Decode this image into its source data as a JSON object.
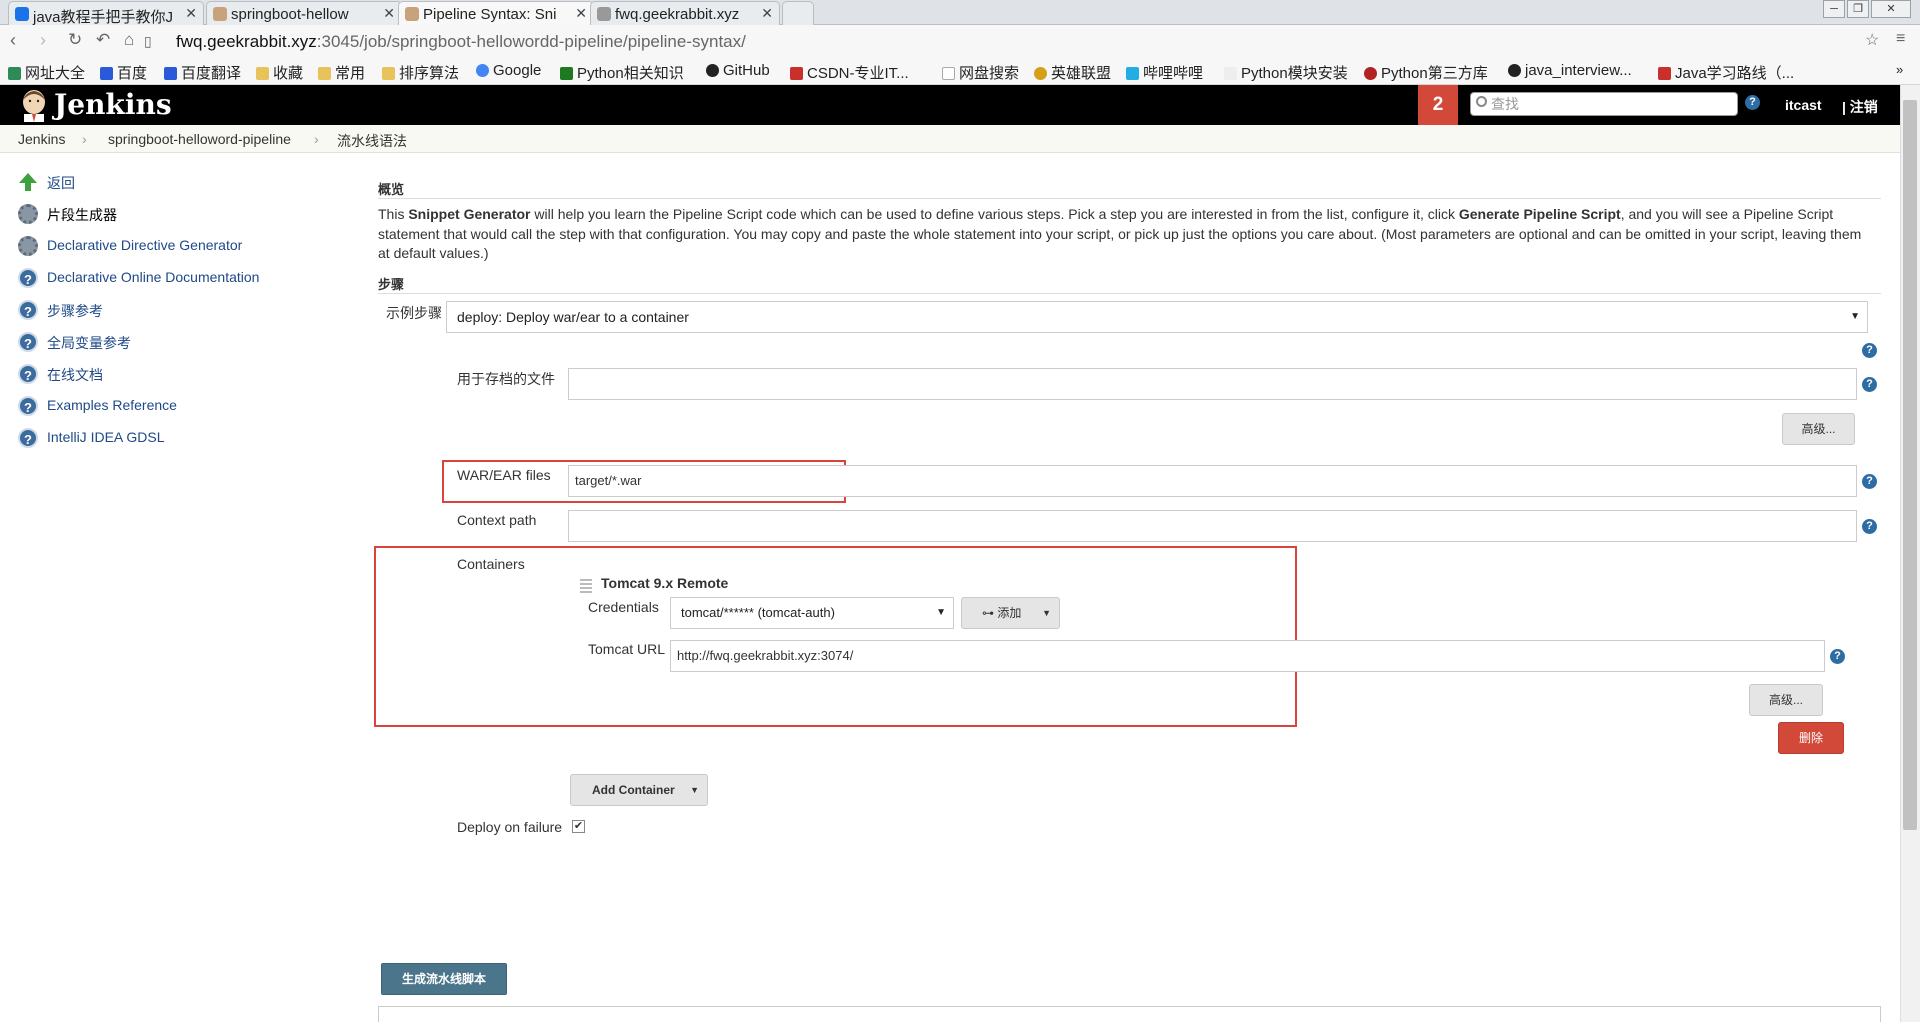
{
  "browser": {
    "tabs": [
      {
        "title": "java教程手把手教你J",
        "icon_color": "#1a73e8"
      },
      {
        "title": "springboot-hellow",
        "icon_color": "#8a6d3b"
      },
      {
        "title": "Pipeline Syntax: Sni",
        "icon_color": "#8a6d3b"
      },
      {
        "title": "fwq.geekrabbit.xyz",
        "icon_color": "#777777"
      }
    ],
    "url_host": "fwq.geekrabbit.xyz",
    "url_rest": ":3045/job/springboot-hellowordd-pipeline/pipeline-syntax/",
    "bookmarks": [
      {
        "label": "网址大全",
        "color": "#2e8b57"
      },
      {
        "label": "百度",
        "color": "#2a5ad8"
      },
      {
        "label": "百度翻译",
        "color": "#2a5ad8"
      },
      {
        "label": "收藏",
        "color": "#e8c25a"
      },
      {
        "label": "常用",
        "color": "#e8c25a"
      },
      {
        "label": "排序算法",
        "color": "#e8c25a"
      },
      {
        "label": "Google",
        "color": "#4285f4"
      },
      {
        "label": "Python相关知识",
        "color": "#1f7a1f"
      },
      {
        "label": "GitHub",
        "color": "#222222"
      },
      {
        "label": "CSDN-专业IT...",
        "color": "#c9302c"
      },
      {
        "label": "网盘搜索",
        "color": "#aaaaaa"
      },
      {
        "label": "英雄联盟",
        "color": "#d4a017"
      },
      {
        "label": "哔哩哔哩",
        "color": "#23ade5"
      },
      {
        "label": "Python模块安装",
        "color": "#dddddd"
      },
      {
        "label": "Python第三方库",
        "color": "#b22222"
      },
      {
        "label": "java_interview...",
        "color": "#222222"
      },
      {
        "label": "Java学习路线（...",
        "color": "#c9302c"
      }
    ]
  },
  "header": {
    "logo": "Jenkins",
    "notification_count": "2",
    "search_placeholder": "查找",
    "user": "itcast",
    "logout": "| 注销"
  },
  "breadcrumb": [
    "Jenkins",
    "springboot-helloword-pipeline",
    "流水线语法"
  ],
  "sidebar": [
    {
      "label": "返回",
      "icon": "up-arrow-icon"
    },
    {
      "label": "片段生成器",
      "icon": "gear-icon"
    },
    {
      "label": "Declarative Directive Generator",
      "icon": "gear-icon"
    },
    {
      "label": "Declarative Online Documentation",
      "icon": "help-icon"
    },
    {
      "label": "步骤参考",
      "icon": "help-icon"
    },
    {
      "label": "全局变量参考",
      "icon": "help-icon"
    },
    {
      "label": "在线文档",
      "icon": "help-icon"
    },
    {
      "label": "Examples Reference",
      "icon": "help-icon"
    },
    {
      "label": "IntelliJ IDEA GDSL",
      "icon": "help-icon"
    }
  ],
  "main": {
    "overview_title": "概览",
    "desc_1": "This ",
    "desc_bold1": "Snippet Generator",
    "desc_2": " will help you learn the Pipeline Script code which can be used to define various steps. Pick a step you are interested in from the list, configure it, click ",
    "desc_bold2": "Generate Pipeline Script",
    "desc_3": ", and you will see a Pipeline Script statement that would call the step with that configuration. You may copy and paste the whole statement into your script, or pick up just the options you care about. (Most parameters are optional and can be omitted in your script, leaving them at default values.)",
    "steps_title": "步骤",
    "sample_step_label": "示例步骤",
    "sample_step_value": "deploy: Deploy war/ear to a container",
    "archive_label": "用于存档的文件",
    "archive_value": "",
    "advanced_label": "高级...",
    "war_label": "WAR/EAR files",
    "war_value": "target/*.war",
    "context_label": "Context path",
    "context_value": "",
    "containers_label": "Containers",
    "container_title": "Tomcat 9.x Remote",
    "credentials_label": "Credentials",
    "credentials_value": "tomcat/****** (tomcat-auth)",
    "add_label": "添加",
    "tomcat_url_label": "Tomcat URL",
    "tomcat_url_value": "http://fwq.geekrabbit.xyz:3074/",
    "container_advanced_label": "高级...",
    "delete_label": "删除",
    "add_container_label": "Add Container",
    "deploy_failure_label": "Deploy on failure",
    "deploy_failure_checked": "✔",
    "generate_label": "生成流水线脚本"
  },
  "colors": {
    "header": "#000000",
    "badge": "#d24939",
    "highlight": "#d9453d",
    "generate_button": "#4b758b"
  }
}
